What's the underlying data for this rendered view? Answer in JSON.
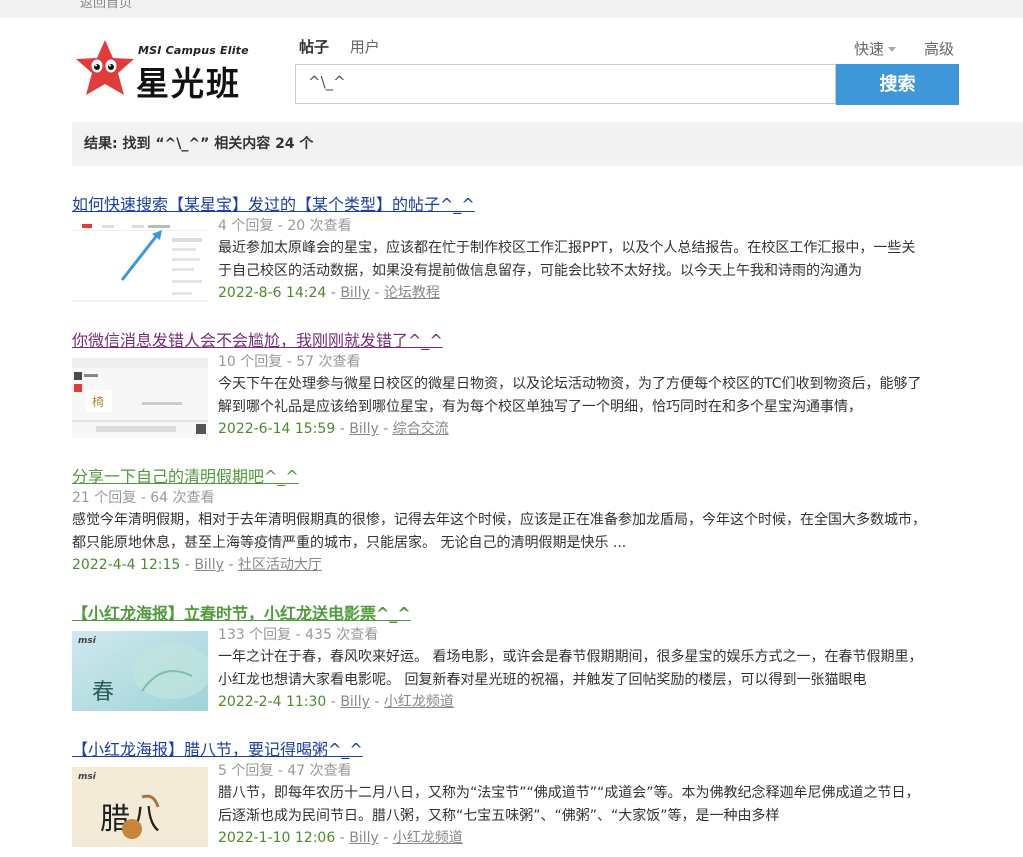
{
  "topbar": {
    "back_label": "返回首页"
  },
  "logo": {
    "en": "MSI Campus Elite",
    "cn": "星光班"
  },
  "tabs": [
    {
      "label": "帖子"
    },
    {
      "label": "用户"
    }
  ],
  "quick": {
    "label": "快速"
  },
  "advanced": {
    "label": "高级"
  },
  "search": {
    "value": "^\\_^",
    "button": "搜索"
  },
  "results_text": "结果: 找到 “^\\_^” 相关内容 24 个",
  "posts": [
    {
      "title": "如何快速搜索【某星宝】发过的【某个类型】的帖子^_^",
      "stats": "4 个回复 - 20 次查看",
      "excerpt": "最近参加太原峰会的星宝，应该都在忙于制作校区工作汇报PPT，以及个人总结报告。在校区工作汇报中，一些关于自己校区的活动数据，如果没有提前做信息留存，可能会比较不太好找。以今天上午我和诗雨的沟通为",
      "date": "2022-8-6 14:24",
      "author": "Billy",
      "forum": "论坛教程",
      "title_color": "#1a3ea8"
    },
    {
      "title": "你微信消息发错人会不会尴尬，我刚刚就发错了^_^",
      "stats": "10 个回复 - 57 次查看",
      "excerpt": "今天下午在处理参与微星日校区的微星日物资，以及论坛活动物资，为了方便每个校区的TC们收到物资后，能够了解到哪个礼品是应该给到哪位星宝，有为每个校区单独写了一个明细，恰巧同时在和多个星宝沟通事情，",
      "date": "2022-6-14 15:59",
      "author": "Billy",
      "forum": "综合交流",
      "title_color": "#7a2c7a"
    },
    {
      "title": "分享一下自己的清明假期吧^_^",
      "stats": "21 个回复 - 64 次查看",
      "excerpt": "感觉今年清明假期，相对于去年清明假期真的很惨，记得去年这个时候，应该是正在准备参加龙盾局，今年这个时候，在全国大多数城市，都只能原地休息，甚至上海等疫情严重的城市，只能居家。 无论自己的清明假期是快乐 ...",
      "date": "2022-4-4 12:15",
      "author": "Billy",
      "forum": "社区活动大厅",
      "title_color": "#4f9a3a"
    },
    {
      "title": "【小红龙海报】立春时节，小红龙送电影票^_^",
      "stats": "133 个回复 - 435 次查看",
      "excerpt": "一年之计在于春，春风吹来好运。 看场电影，或许会是春节假期期间，很多星宝的娱乐方式之一，在春节假期里，小红龙也想请大家看电影呢。 回复新春对星光班的祝福，并触发了回帖奖励的楼层，可以得到一张猫眼电",
      "date": "2022-2-4 11:30",
      "author": "Billy",
      "forum": "小红龙频道",
      "title_color": "#4f9a3a"
    },
    {
      "title": "【小红龙海报】腊八节，要记得喝粥^_^",
      "stats": "5 个回复 - 47 次查看",
      "excerpt": "腊八节，即每年农历十二月八日，又称为“法宝节”“佛成道节”“成道会”等。本为佛教纪念释迦牟尼佛成道之节日，后逐渐也成为民间节日。腊八粥，又称“七宝五味粥”、“佛粥”、“大家饭”等，是一种由多样",
      "date": "2022-1-10 12:06",
      "author": "Billy",
      "forum": "小红龙频道",
      "title_color": "#1a3ea8"
    }
  ],
  "thumb_texts": {
    "msi": "msi",
    "spring": "春",
    "laba": "腊八"
  }
}
